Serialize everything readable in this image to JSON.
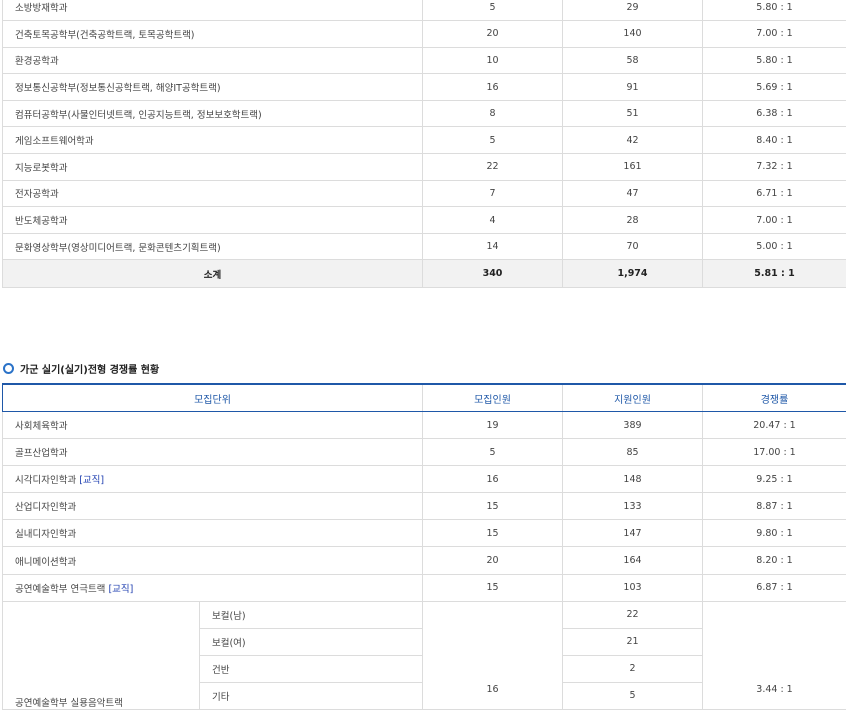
{
  "table1": {
    "rows": [
      {
        "name": "소방방재학과",
        "quota": "5",
        "applicants": "29",
        "ratio": "5.80 : 1"
      },
      {
        "name": "건축토목공학부(건축공학트랙, 토목공학트랙)",
        "quota": "20",
        "applicants": "140",
        "ratio": "7.00 : 1"
      },
      {
        "name": "환경공학과",
        "quota": "10",
        "applicants": "58",
        "ratio": "5.80 : 1"
      },
      {
        "name": "정보통신공학부(정보통신공학트랙, 해양IT공학트랙)",
        "quota": "16",
        "applicants": "91",
        "ratio": "5.69 : 1"
      },
      {
        "name": "컴퓨터공학부(사물인터넷트랙, 인공지능트랙, 정보보호학트랙)",
        "quota": "8",
        "applicants": "51",
        "ratio": "6.38 : 1"
      },
      {
        "name": "게임소프트웨어학과",
        "quota": "5",
        "applicants": "42",
        "ratio": "8.40 : 1"
      },
      {
        "name": "지능로봇학과",
        "quota": "22",
        "applicants": "161",
        "ratio": "7.32 : 1"
      },
      {
        "name": "전자공학과",
        "quota": "7",
        "applicants": "47",
        "ratio": "6.71 : 1"
      },
      {
        "name": "반도체공학과",
        "quota": "4",
        "applicants": "28",
        "ratio": "7.00 : 1"
      },
      {
        "name": "문화영상학부(영상미디어트랙, 문화콘텐츠기획트랙)",
        "quota": "14",
        "applicants": "70",
        "ratio": "5.00 : 1"
      }
    ],
    "subtotal": {
      "label": "소계",
      "quota": "340",
      "applicants": "1,974",
      "ratio": "5.81 : 1"
    }
  },
  "section2": {
    "title": "가군 실기(실기)전형 경쟁률 현황",
    "headers": {
      "unit": "모집단위",
      "quota": "모집인원",
      "applicants": "지원인원",
      "ratio": "경쟁률"
    },
    "rows": [
      {
        "name": "사회체육학과",
        "quota": "19",
        "applicants": "389",
        "ratio": "20.47 : 1"
      },
      {
        "name": "골프산업학과",
        "quota": "5",
        "applicants": "85",
        "ratio": "17.00 : 1"
      },
      {
        "name": "시각디자인학과",
        "link": "[교직]",
        "quota": "16",
        "applicants": "148",
        "ratio": "9.25 : 1"
      },
      {
        "name": "산업디자인학과",
        "quota": "15",
        "applicants": "133",
        "ratio": "8.87 : 1"
      },
      {
        "name": "실내디자인학과",
        "quota": "15",
        "applicants": "147",
        "ratio": "9.80 : 1"
      },
      {
        "name": "애니메이션학과",
        "quota": "20",
        "applicants": "164",
        "ratio": "8.20 : 1"
      },
      {
        "name": "공연예술학부 연극트랙",
        "link": "[교직]",
        "quota": "15",
        "applicants": "103",
        "ratio": "6.87 : 1"
      }
    ],
    "music": {
      "name": "공연예술학부 실용음악트랙",
      "quota": "16",
      "ratio": "3.44 : 1",
      "subs": [
        {
          "label": "보컬(남)",
          "applicants": "22"
        },
        {
          "label": "보컬(여)",
          "applicants": "21"
        },
        {
          "label": "건반",
          "applicants": "2"
        },
        {
          "label": "기타",
          "applicants": "5"
        }
      ]
    }
  }
}
